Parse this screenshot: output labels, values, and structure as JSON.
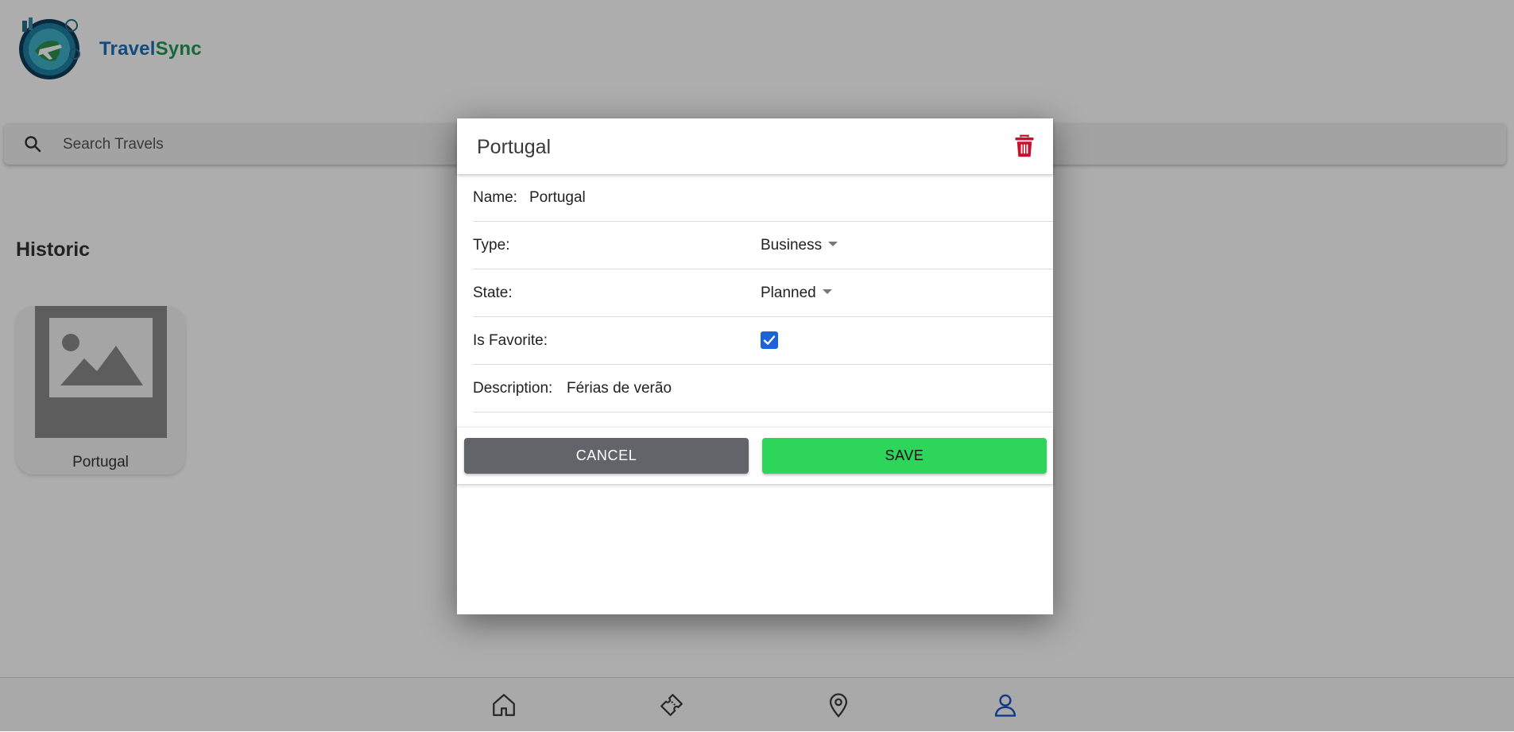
{
  "app": {
    "brand_part1": "Travel",
    "brand_part2": "Sync"
  },
  "search": {
    "placeholder": "Search Travels",
    "value": ""
  },
  "historic": {
    "title": "Historic",
    "cards": [
      {
        "name": "Portugal"
      }
    ]
  },
  "nav": {
    "items": [
      {
        "icon": "home-icon",
        "active": false
      },
      {
        "icon": "ticket-icon",
        "active": false
      },
      {
        "icon": "location-pin-icon",
        "active": false
      },
      {
        "icon": "person-icon",
        "active": true
      }
    ]
  },
  "modal": {
    "title": "Portugal",
    "fields": {
      "name_label": "Name:",
      "name_value": "Portugal",
      "type_label": "Type:",
      "type_value": "Business",
      "state_label": "State:",
      "state_value": "Planned",
      "favorite_label": "Is Favorite:",
      "favorite_checked": true,
      "description_label": "Description:",
      "description_value": "Férias de verão"
    },
    "cancel_label": "CANCEL",
    "save_label": "SAVE"
  },
  "colors": {
    "brand_blue": "#1b6fb8",
    "brand_green": "#1f9a55",
    "delete_red": "#c8102e",
    "save_green": "#2dd55b",
    "cancel_gray": "#636469",
    "checkbox_blue": "#1a63d8",
    "nav_active": "#1a55c8"
  }
}
